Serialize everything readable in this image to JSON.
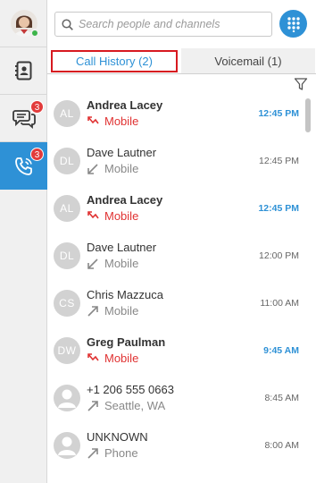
{
  "rail": {
    "profile_icon": "user-avatar",
    "contacts_icon": "contacts-icon",
    "chat_icon": "chat-icon",
    "chat_badge": "3",
    "calls_icon": "phone-calls-icon",
    "calls_badge": "3"
  },
  "search": {
    "placeholder": "Search people and channels",
    "value": ""
  },
  "tabs": [
    {
      "label": "Call History (2)",
      "selected": true
    },
    {
      "label": "Voicemail (1)",
      "selected": false
    }
  ],
  "colors": {
    "accent": "#2e91d6",
    "missed": "#e03232",
    "badge": "#e23b3b",
    "online": "#3cb44a"
  },
  "calls": [
    {
      "initials": "AL",
      "name": "Andrea Lacey",
      "detail": "Mobile",
      "direction": "missed",
      "time": "12:45 PM"
    },
    {
      "initials": "DL",
      "name": "Dave Lautner",
      "detail": "Mobile",
      "direction": "incoming",
      "time": "12:45 PM"
    },
    {
      "initials": "AL",
      "name": "Andrea Lacey",
      "detail": "Mobile",
      "direction": "missed",
      "time": "12:45 PM"
    },
    {
      "initials": "DL",
      "name": "Dave Lautner",
      "detail": "Mobile",
      "direction": "incoming",
      "time": "12:00 PM"
    },
    {
      "initials": "CS",
      "name": "Chris Mazzuca",
      "detail": "Mobile",
      "direction": "outgoing",
      "time": "11:00 AM"
    },
    {
      "initials": "DW",
      "name": "Greg Paulman",
      "detail": "Mobile",
      "direction": "missed",
      "time": "9:45 AM"
    },
    {
      "initials": "",
      "name": "+1 206 555 0663",
      "detail": "Seattle, WA",
      "direction": "outgoing",
      "time": "8:45 AM"
    },
    {
      "initials": "",
      "name": "UNKNOWN",
      "detail": "Phone",
      "direction": "outgoing",
      "time": "8:00 AM"
    }
  ]
}
